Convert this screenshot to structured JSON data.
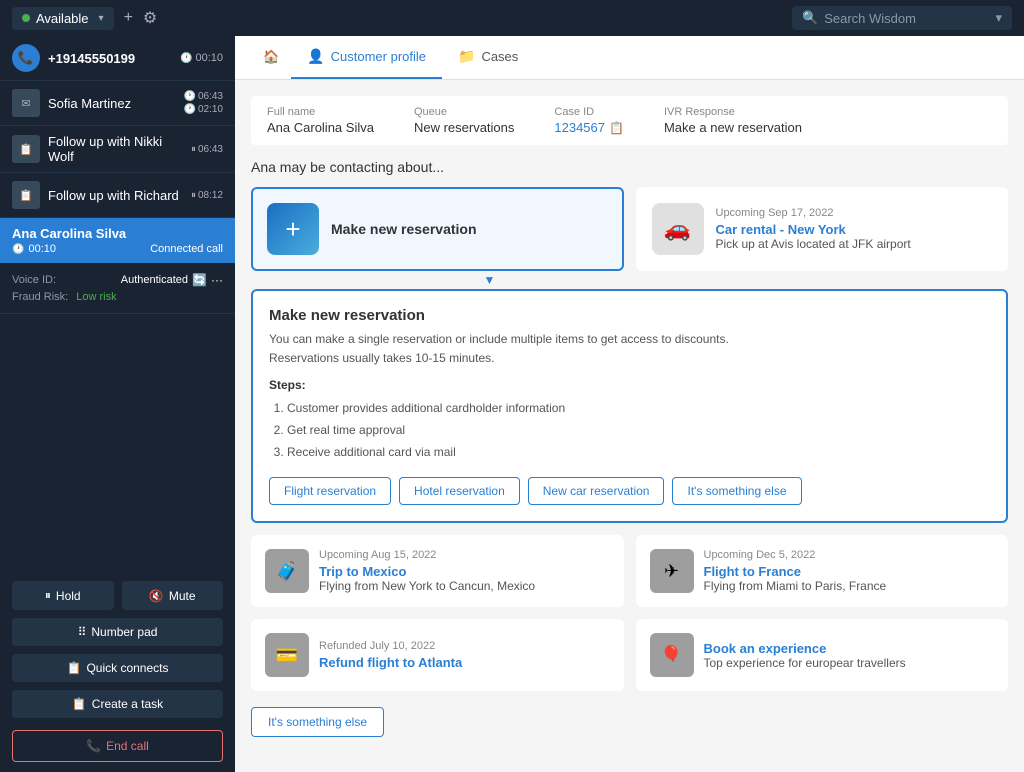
{
  "topBar": {
    "status": "Available",
    "statusColor": "#4caf50",
    "addIcon": "+",
    "settingsIcon": "⚙",
    "searchPlaceholder": "Search Wisdom",
    "dropdownIcon": "▾"
  },
  "sidebar": {
    "callItem": {
      "number": "+19145550199",
      "timeLabel": "00:10"
    },
    "contacts": [
      {
        "name": "Sofia Martinez",
        "time1": "06:43",
        "time2": "02:10"
      },
      {
        "name": "Follow up with Nikki Wolf",
        "time": "06:43"
      },
      {
        "name": "Follow up with Richard",
        "time": "08:12"
      }
    ],
    "activeCall": {
      "name": "Ana Carolina Silva",
      "timer": "00:10",
      "status": "Connected call"
    },
    "voiceId": {
      "label": "Voice ID:",
      "value": "Authenticated"
    },
    "fraudRisk": {
      "label": "Fraud Risk:",
      "value": "Low risk"
    },
    "buttons": {
      "hold": "Hold",
      "mute": "Mute",
      "numberPad": "Number pad",
      "quickConnects": "Quick connects",
      "createTask": "Create a task",
      "endCall": "End call"
    }
  },
  "content": {
    "tabs": {
      "home": "🏠",
      "customerProfile": "Customer profile",
      "cases": "Cases"
    },
    "customerInfo": {
      "fullNameLabel": "Full name",
      "fullNameValue": "Ana Carolina Silva",
      "queueLabel": "Queue",
      "queueValue": "New reservations",
      "caseIdLabel": "Case ID",
      "caseIdValue": "1234567",
      "ivrLabel": "IVR Response",
      "ivrValue": "Make a new reservation"
    },
    "sectionHeading": "Ana may be contacting about...",
    "primaryCards": [
      {
        "id": "make-new-reservation",
        "iconEmoji": "+",
        "title": "Make new reservation",
        "selected": true
      },
      {
        "id": "car-rental",
        "date": "Upcoming Sep 17, 2022",
        "title": "Car rental - New York",
        "desc": "Pick up at Avis located at JFK airport"
      }
    ],
    "expandedPanel": {
      "title": "Make new reservation",
      "desc": "You can make a single reservation or include multiple items to get access to discounts.\nReservations usually takes 10-15 minutes.",
      "stepsLabel": "Steps:",
      "steps": [
        "Customer provides additional cardholder information",
        "Get real time approval",
        "Receive additional card via mail"
      ],
      "actionButtons": [
        "Flight reservation",
        "Hotel reservation",
        "New car reservation",
        "It's something else"
      ]
    },
    "smallCards": [
      {
        "date": "Upcoming Aug 15, 2022",
        "title": "Trip to Mexico",
        "desc": "Flying from New York to Cancun, Mexico",
        "iconEmoji": "🧳"
      },
      {
        "date": "Upcoming Dec 5, 2022",
        "title": "Flight to France",
        "desc": "Flying from Miami to Paris, France",
        "iconEmoji": "✈"
      },
      {
        "date": "Refunded July 10, 2022",
        "title": "Refund flight to Atlanta",
        "desc": "",
        "iconEmoji": "💳"
      },
      {
        "date": "",
        "title": "Book an experience",
        "desc": "Top experience for europear travellers",
        "iconEmoji": "🎈"
      }
    ],
    "itSomethingElse": "It's something else"
  }
}
